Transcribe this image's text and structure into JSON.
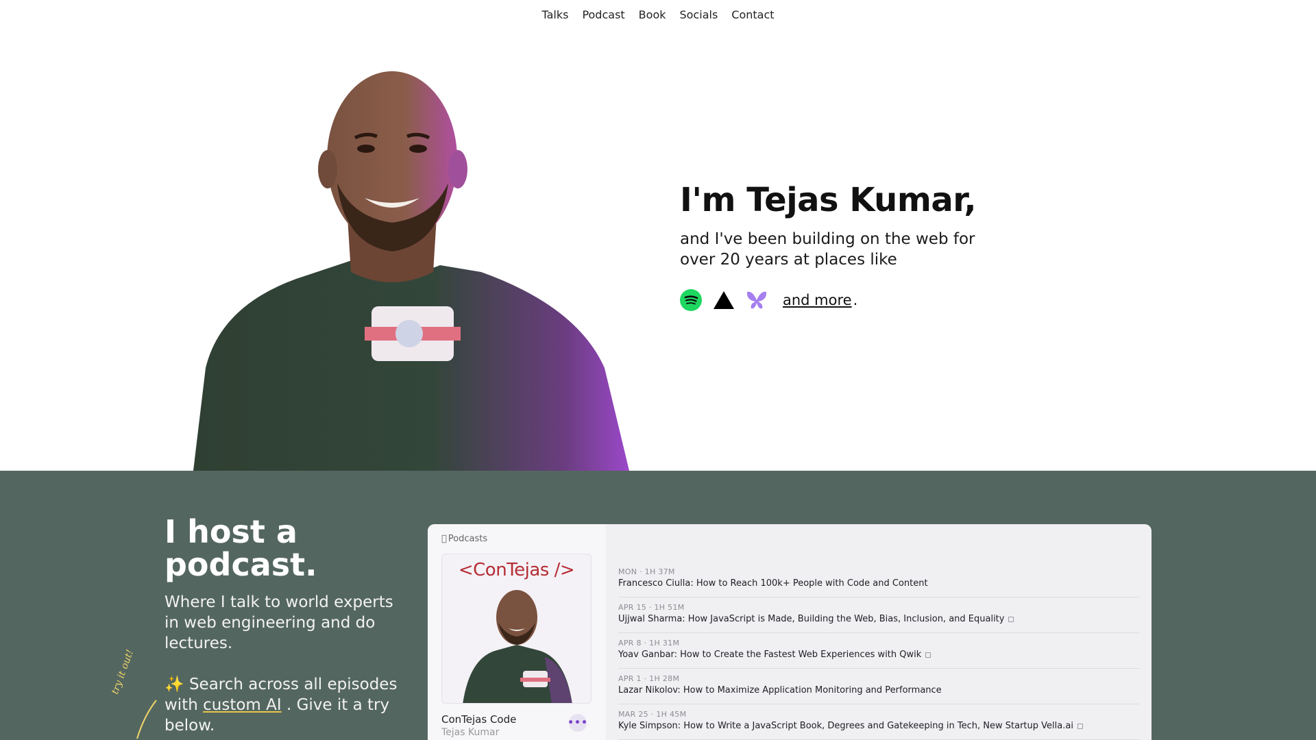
{
  "nav": {
    "items": [
      "Talks",
      "Podcast",
      "Book",
      "Socials",
      "Contact"
    ]
  },
  "hero": {
    "title": "I'm Tejas Kumar,",
    "subtitle": "and I've been building on the web for over 20 years at places like",
    "and_more": "and more",
    "logos": [
      "spotify-icon",
      "vercel-icon",
      "butterfly-icon"
    ]
  },
  "podcast": {
    "title": "I host a podcast.",
    "description": "Where I talk to world experts in web engineering and do lectures.",
    "search_prefix": "✨ Search across all episodes with",
    "search_link": "custom AI",
    "search_suffix": ". Give it a try below.",
    "try_it": "try it out!"
  },
  "embed": {
    "brand": "Podcasts",
    "cover_title": "<ConTejas />",
    "show_name": "ConTejas Code",
    "show_author": "Tejas Kumar",
    "episodes": [
      {
        "meta": "MON · 1H 37M",
        "title": "Francesco Ciulla: How to Reach 100k+ People with Code and Content",
        "explicit": false
      },
      {
        "meta": "APR 15 · 1H 51M",
        "title": "Ujjwal Sharma: How JavaScript is Made, Building the Web, Bias, Inclusion, and Equality",
        "explicit": true
      },
      {
        "meta": "APR 8 · 1H 31M",
        "title": "Yoav Ganbar: How to Create the Fastest Web Experiences with Qwik",
        "explicit": true
      },
      {
        "meta": "APR 1 · 1H 28M",
        "title": "Lazar Nikolov: How to Maximize Application Monitoring and Performance",
        "explicit": false
      },
      {
        "meta": "MAR 25 · 1H 45M",
        "title": "Kyle Simpson: How to Write a JavaScript Book, Degrees and Gatekeeping in Tech, New Startup Vella.ai",
        "explicit": true
      }
    ]
  },
  "colors": {
    "section_bg": "#546660",
    "accent_yellow": "#e6c84a",
    "spotify": "#1ed760",
    "purple": "#7a43c9"
  }
}
